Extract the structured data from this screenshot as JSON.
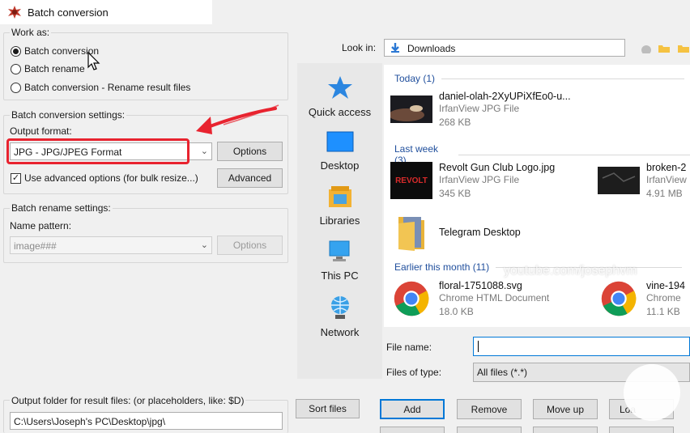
{
  "window": {
    "title": "Batch conversion"
  },
  "work_as": {
    "legend": "Work as:",
    "options": [
      "Batch conversion",
      "Batch rename",
      "Batch conversion - Rename result files"
    ],
    "selected_index": 0
  },
  "conversion": {
    "legend": "Batch conversion settings:",
    "output_format_label": "Output format:",
    "output_format_value": "JPG - JPG/JPEG Format",
    "options_button": "Options",
    "advanced_checkbox_label": "Use advanced options (for bulk resize...)",
    "advanced_checked": true,
    "advanced_button": "Advanced"
  },
  "rename": {
    "legend": "Batch rename settings:",
    "name_pattern_label": "Name pattern:",
    "name_pattern_value": "image###",
    "options_button": "Options"
  },
  "output_folder": {
    "label": "Output folder for result files: (or placeholders, like: $D)",
    "value": "C:\\Users\\Joseph's PC\\Desktop\\jpg\\"
  },
  "dialog": {
    "look_in_label": "Look in:",
    "look_in_value": "Downloads",
    "places": [
      "Quick access",
      "Desktop",
      "Libraries",
      "This PC",
      "Network"
    ],
    "groups": {
      "today": "Today (1)",
      "last_week": "Last week (3)",
      "earlier": "Earlier this month (11)"
    },
    "files": {
      "f1": {
        "name": "daniel-olah-2XyUPiXfEo0-u...",
        "type": "IrfanView JPG File",
        "size": "268 KB"
      },
      "f2": {
        "name": "Revolt Gun Club Logo.jpg",
        "type": "IrfanView JPG File",
        "size": "345 KB"
      },
      "f3": {
        "name": "broken-2",
        "type": "IrfanView",
        "size": "4.91 MB"
      },
      "f4": {
        "name": "Telegram Desktop"
      },
      "f5": {
        "name": "floral-1751088.svg",
        "type": "Chrome HTML Document",
        "size": "18.0 KB"
      },
      "f6": {
        "name": "vine-194",
        "type": "Chrome",
        "size": "11.1 KB"
      }
    },
    "thumb_logo_text": "REVOLT",
    "file_name_label": "File name:",
    "file_name_value": "",
    "files_of_type_label": "Files of type:",
    "files_of_type_value": "All files (*.*)"
  },
  "buttons": {
    "sort_files": "Sort files",
    "add": "Add",
    "remove": "Remove",
    "move_up": "Move up",
    "load": "Loa"
  },
  "watermark": "youtube.com/josephvm",
  "colors": {
    "accent": "#0078d7",
    "highlight_red": "#e8232f",
    "group_heading": "#1f4e9c"
  }
}
